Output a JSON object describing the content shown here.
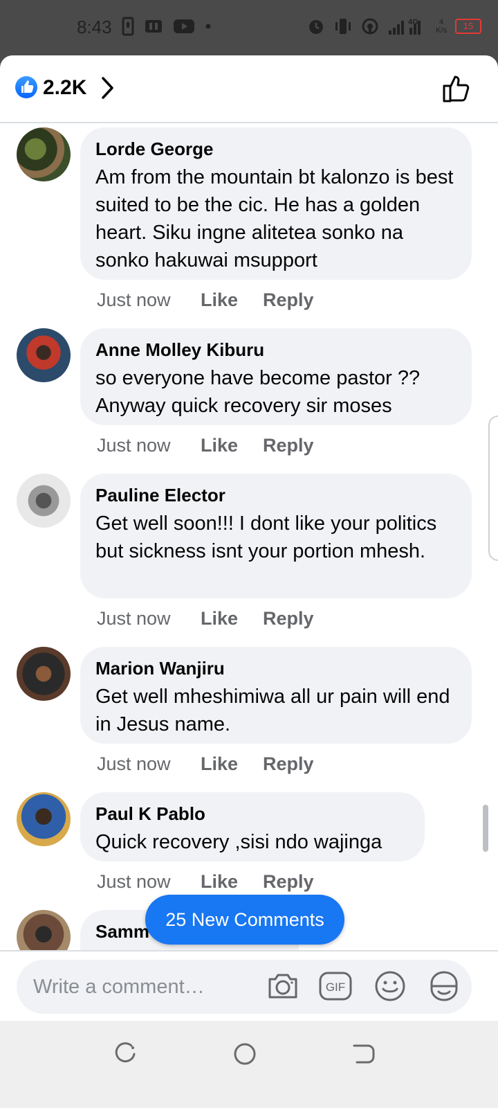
{
  "status_bar": {
    "time": "8:43",
    "network": "4G",
    "net_speed_value": "4",
    "net_speed_unit": "K/s",
    "battery": "15"
  },
  "header": {
    "reaction_count": "2.2K"
  },
  "comments": [
    {
      "author": "Lorde George",
      "text": "Am from the mountain bt kalonzo is best suited to be the cic. He has a golden heart. Siku ingne alitetea sonko na sonko hakuwai msupport",
      "time": "Just now",
      "like": "Like",
      "reply": "Reply"
    },
    {
      "author": "Anne Molley Kiburu",
      "text": "so everyone have become pastor ?? Anyway quick recovery sir moses",
      "time": "Just now",
      "like": "Like",
      "reply": "Reply"
    },
    {
      "author": "Pauline Elector",
      "text": "Get well soon!!! I dont like your politics but sickness isnt your portion mhesh.",
      "time": "Just now",
      "like": "Like",
      "reply": "Reply"
    },
    {
      "author": "Marion Wanjiru",
      "text": "Get well mheshimiwa all ur pain will end in Jesus name.",
      "time": "Just now",
      "like": "Like",
      "reply": "Reply"
    },
    {
      "author": "Paul K Pablo",
      "text": "Quick recovery ,sisi ndo wajinga",
      "time": "Just now",
      "like": "Like",
      "reply": "Reply"
    },
    {
      "author": "Samm",
      "text": "",
      "time": "",
      "like": "",
      "reply": ""
    }
  ],
  "new_comments_label": "25 New Comments",
  "composer": {
    "placeholder": "Write a comment…",
    "gif_label": "GIF"
  },
  "colors": {
    "accent": "#1877f2",
    "bubble": "#f0f2f5",
    "secondary_text": "#65676b",
    "battery_low": "#e53935"
  },
  "icons": [
    "alarm-icon",
    "vibrate-icon",
    "hotspot-icon",
    "signal-icon",
    "camera-icon",
    "gif-icon",
    "emoji-icon",
    "sticker-icon",
    "thumbs-up-icon",
    "chevron-right-icon"
  ]
}
